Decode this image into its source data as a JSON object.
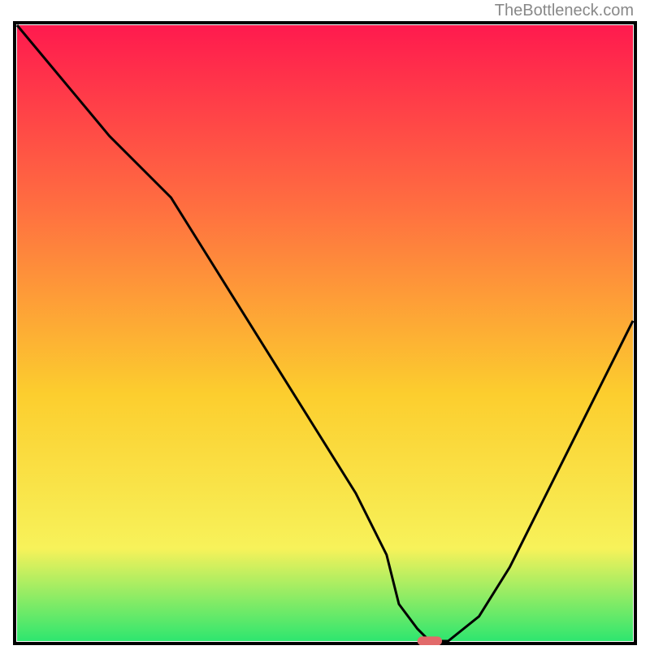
{
  "watermark": "TheBottleneck.com",
  "chart_data": {
    "type": "line",
    "title": "",
    "xlabel": "",
    "ylabel": "",
    "xlim": [
      0,
      100
    ],
    "ylim": [
      0,
      100
    ],
    "grid": false,
    "x": [
      0,
      5,
      10,
      15,
      20,
      25,
      30,
      35,
      40,
      45,
      50,
      55,
      60,
      62,
      65,
      67,
      70,
      75,
      80,
      85,
      90,
      95,
      100
    ],
    "values": [
      100,
      94,
      88,
      82,
      77,
      72,
      64,
      56,
      48,
      40,
      32,
      24,
      14,
      6,
      2,
      0,
      0,
      4,
      12,
      22,
      32,
      42,
      52
    ],
    "gradient_bg": {
      "top": "#ff1a4e",
      "mid_upper": "#ff7040",
      "mid": "#fcce2e",
      "mid_lower": "#f7f25a",
      "bottom": "#2ee66f"
    },
    "marker": {
      "x": 67,
      "y": 0,
      "color": "#e26a6a",
      "width_pct": 4,
      "height_pct": 1.5
    }
  }
}
